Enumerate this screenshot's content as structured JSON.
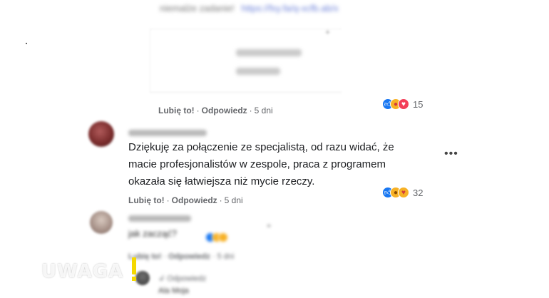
{
  "top_link": {
    "prefix": "niemalże zadanie!",
    "url": "https://fxy.fa/q-xcfb.ab/x"
  },
  "post_reply": {
    "like_label": "Lubię to!",
    "reply_label": "Odpowiedz",
    "time": "5 dni",
    "reaction_count": "15"
  },
  "main_comment": {
    "lines": [
      "Dziękuję za połączenie ze specjalistą, od razu widać, że",
      "macie profesjonalistów w zespole, praca z programem",
      "okazała się łatwiejsza niż mycie rzeczy."
    ],
    "like_label": "Lubię to!",
    "reply_label": "Odpowiedz",
    "time": "5 dni",
    "reaction_count": "32"
  },
  "lower_comment": {
    "text": "jak zacząć?",
    "like_label": "Lubię to!",
    "reply_label": "Odpowiedz",
    "time": "5 dni",
    "reply_prompt": "Odpowiedz",
    "reply_preview": "Ala Moja"
  },
  "watermark": {
    "text": "UWAGA"
  },
  "colors": {
    "link": "#6a7fd8",
    "meta_text": "#65676b",
    "body_text": "#1c1e21",
    "watermark_accent": "#f5d800"
  }
}
